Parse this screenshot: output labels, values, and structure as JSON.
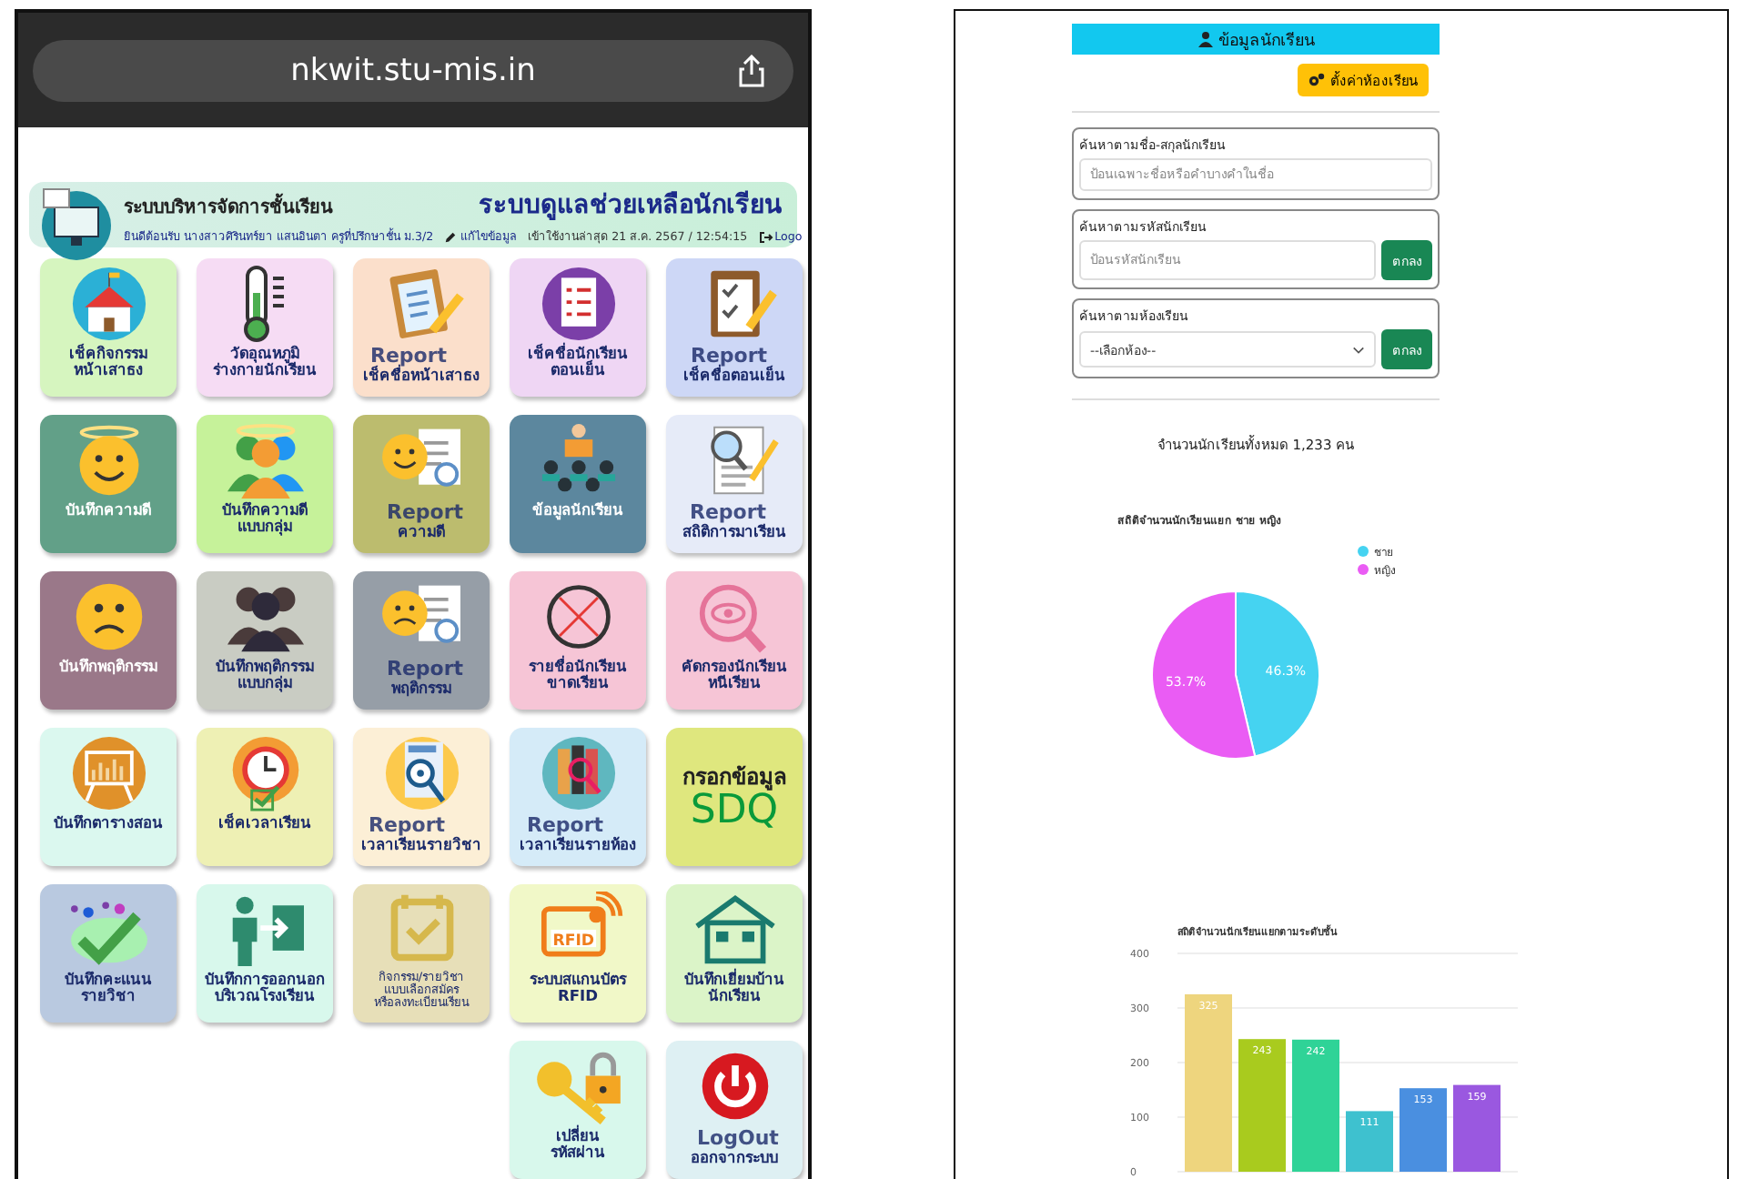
{
  "browser": {
    "url": "nkwit.stu-mis.in"
  },
  "header": {
    "system_title": "ระบบบริหารจัดการชั้นเรียน",
    "title": "ระบบดูแลช่วยเหลือนักเรียน",
    "welcome": "ยินดีต้อนรับ นางสาวศิรินทร์ยา แสนอินตา ครูที่ปรึกษาชั้น ม.3/2",
    "edit_link": "แก้ไขข้อมูล",
    "last_login": "เข้าใช้งานล่าสุด 21 ส.ค. 2567 / 12:54:15",
    "logout_link": "Logo"
  },
  "tiles": [
    {
      "kind": "plain",
      "label": [
        "เช็คกิจกรรม",
        "หน้าเสาธง"
      ],
      "color": "#d6f5bf"
    },
    {
      "kind": "plain",
      "label": [
        "วัดอุณหภูมิ",
        "ร่างกายนักเรียน"
      ],
      "color": "#f6dcf4"
    },
    {
      "kind": "report",
      "label": [
        "Report",
        "เช็คชื่อหน้าเสาธง"
      ],
      "color": "#fbdfcb"
    },
    {
      "kind": "plain",
      "label": [
        "เช็คชื่อนักเรียน",
        "ตอนเย็น"
      ],
      "color": "#efd6f4"
    },
    {
      "kind": "report",
      "label": [
        "Report",
        "เช็คชื่อตอนเย็น"
      ],
      "color": "#cdd7f6"
    },
    {
      "kind": "plain",
      "label": [
        "บันทึกความดี"
      ],
      "color": "#62a088"
    },
    {
      "kind": "plain",
      "label": [
        "บันทึกความดี",
        "แบบกลุ่ม"
      ],
      "color": "#c6f29a"
    },
    {
      "kind": "report",
      "label": [
        "Report",
        "ความดี"
      ],
      "color": "#bcbc6e"
    },
    {
      "kind": "plain",
      "label": [
        "ข้อมูลนักเรียน"
      ],
      "color": "#5c879e"
    },
    {
      "kind": "report",
      "label": [
        "Report",
        "สถิติการมาเรียน"
      ],
      "color": "#e6ebf8"
    },
    {
      "kind": "plain",
      "label": [
        "บันทึกพฤติกรรม"
      ],
      "color": "#9a7889"
    },
    {
      "kind": "plain",
      "label": [
        "บันทึกพฤติกรรม",
        "แบบกลุ่ม"
      ],
      "color": "#c9ccc3"
    },
    {
      "kind": "report",
      "label": [
        "Report",
        "พฤติกรรม"
      ],
      "color": "#969ea7"
    },
    {
      "kind": "plain",
      "label": [
        "รายชื่อนักเรียน",
        "ขาดเรียน"
      ],
      "color": "#f6c5d6"
    },
    {
      "kind": "plain",
      "label": [
        "คัดกรองนักเรียน",
        "หนีเรียน"
      ],
      "color": "#f6c5d6"
    },
    {
      "kind": "plain",
      "label": [
        "บันทึกตารางสอน"
      ],
      "color": "#dbf8ef"
    },
    {
      "kind": "plain",
      "label": [
        "เช็คเวลาเรียน"
      ],
      "color": "#eef0b4"
    },
    {
      "kind": "report",
      "label": [
        "Report",
        "เวลาเรียนรายวิชา"
      ],
      "color": "#fcefd6"
    },
    {
      "kind": "report",
      "label": [
        "Report",
        "เวลาเรียนรายห้อง"
      ],
      "color": "#d5ebf8"
    },
    {
      "kind": "big",
      "label": [
        "กรอกข้อมูล",
        "SDQ"
      ],
      "color": "#dfe77e"
    },
    {
      "kind": "plain",
      "label": [
        "บันทึกคะแนน",
        "รายวิชา"
      ],
      "color": "#b9c9e0"
    },
    {
      "kind": "plain",
      "label": [
        "บันทึกการออกนอก",
        "บริเวณโรงเรียน"
      ],
      "color": "#d8f8ec"
    },
    {
      "kind": "small",
      "label": [
        "กิจกรรม/รายวิชา",
        "แบบเลือกสมัคร",
        "หรือลงทะเบียนเรียน"
      ],
      "color": "#e7dfb8"
    },
    {
      "kind": "plain",
      "icon_text": "RFID",
      "label": [
        "ระบบสแกนบัตร",
        "RFID"
      ],
      "color": "#f1f8c8"
    },
    {
      "kind": "plain",
      "label": [
        "บันทึกเยี่ยมบ้าน",
        "นักเรียน"
      ],
      "color": "#dbf4c8"
    },
    {
      "kind": "plain",
      "label": [
        "เปลี่ยน",
        "รหัสผ่าน"
      ],
      "color": "#d8f8ec"
    },
    {
      "kind": "report",
      "label": [
        "LogOut",
        "ออกจากระบบ"
      ],
      "color": "#def0f3"
    }
  ],
  "student_panel": {
    "title": "ข้อมูลนักเรียน",
    "settings_button": "ตั้งค่าห้องเรียน",
    "search_groups": [
      {
        "kind": "text",
        "label": "ค้นหาตามชื่อ-สกุลนักเรียน",
        "placeholder": "ป้อนเฉพาะชื่อหรือคำบางคำในชื่อ"
      },
      {
        "kind": "text_button",
        "label": "ค้นหาตามรหัสนักเรียน",
        "placeholder": "ป้อนรหัสนักเรียน",
        "button": "ตกลง"
      },
      {
        "kind": "select",
        "label": "ค้นหาตามห้องเรียน",
        "value": "--เลือกห้อง--",
        "button": "ตกลง"
      }
    ],
    "total": "จำนวนนักเรียนทั้งหมด 1,233 คน",
    "gender_chart": {
      "chart_data": {
        "type": "pie",
        "title": "สถิติจำนวนนักเรียนแยก ชาย หญิง",
        "categories": [
          "ชาย",
          "หญิง"
        ],
        "values": [
          46.3,
          53.7
        ],
        "colors": [
          "#45d3f1",
          "#ea5cf4"
        ],
        "legend": true,
        "value_labels": [
          "46.3%",
          "53.7%"
        ]
      }
    },
    "grade_chart": {
      "chart_data": {
        "type": "bar",
        "title": "สถิติจำนวนนักเรียนแยกตามระดับชั้น",
        "values": [
          325,
          243,
          242,
          111,
          153,
          159
        ],
        "colors": [
          "#eed57e",
          "#a9cb1e",
          "#2fd397",
          "#3ec1cf",
          "#4a8fe0",
          "#9a58e0"
        ],
        "ylim": [
          0,
          400
        ],
        "yticks": [
          0,
          100,
          200,
          300,
          400
        ],
        "grid": true,
        "data_labels": true
      }
    }
  }
}
